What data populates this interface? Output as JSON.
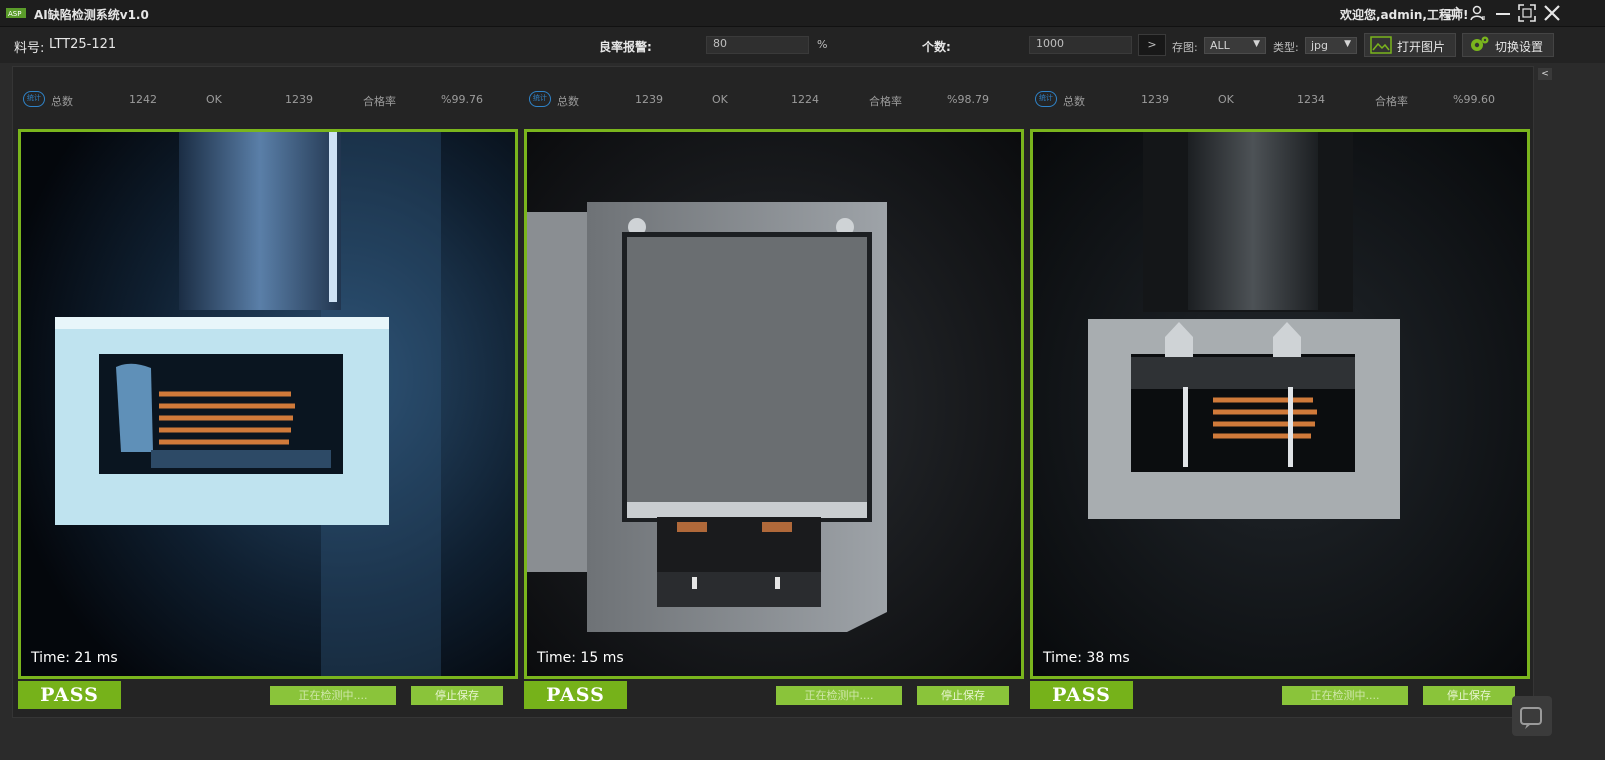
{
  "titlebar": {
    "app_title": "AI缺陷检测系统v1.0",
    "user_text": "欢迎您,admin,工程师!"
  },
  "toolbar": {
    "material_label": "料号:",
    "material_value": "LTT25-121",
    "yield_alarm_label": "良率报警:",
    "yield_alarm_value": "80",
    "percent_unit": "%",
    "count_label": "个数:",
    "count_value": "1000",
    "go_button": ">",
    "save_image_label": "存图:",
    "save_image_value": "ALL",
    "type_label": "类型:",
    "type_value": "jpg",
    "open_image_button": "打开图片",
    "switch_settings_button": "切换设置"
  },
  "stat_icon_text": "统计",
  "panels": [
    {
      "total_label": "总数",
      "total_value": "1242",
      "ok_label": "OK",
      "ok_value": "1239",
      "rate_label": "合格率",
      "rate_value": "%99.76",
      "time_text": "Time: 21 ms",
      "result": "PASS",
      "status_button": "正在检测中....",
      "stop_button": "停止保存"
    },
    {
      "total_label": "总数",
      "total_value": "1239",
      "ok_label": "OK",
      "ok_value": "1224",
      "rate_label": "合格率",
      "rate_value": "%98.79",
      "time_text": "Time: 15 ms",
      "result": "PASS",
      "status_button": "正在检测中....",
      "stop_button": "停止保存"
    },
    {
      "total_label": "总数",
      "total_value": "1239",
      "ok_label": "OK",
      "ok_value": "1234",
      "rate_label": "合格率",
      "rate_value": "%99.60",
      "time_text": "Time: 38 ms",
      "result": "PASS",
      "status_button": "正在检测中....",
      "stop_button": "停止保存"
    }
  ],
  "colors": {
    "accent_green": "#7ab51d",
    "pass_green": "#76b21a",
    "button_green": "#8ac43a",
    "icon_blue": "#2f83c8"
  }
}
